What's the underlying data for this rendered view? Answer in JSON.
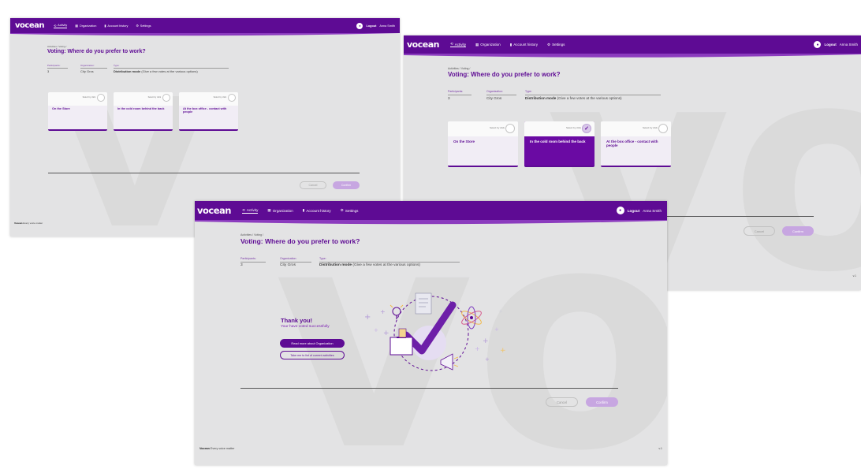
{
  "app": {
    "logo": "vocean",
    "nav": [
      {
        "label": "Activity",
        "icon": "activity-icon",
        "active": true
      },
      {
        "label": "Organization",
        "icon": "organization-icon"
      },
      {
        "label": "Account history",
        "icon": "account-history-icon"
      },
      {
        "label": "Settings",
        "icon": "gear-icon"
      }
    ],
    "logout": "Logout",
    "user": "Anna Smith",
    "footer_brand": "Vocean",
    "footer_tagline": "Every voice matter",
    "version": "v.1",
    "colors": {
      "brand": "#5e0b94",
      "background": "#e3e3e4",
      "confirm": "#c7a6e1"
    }
  },
  "poll": {
    "breadcrumb": "Activities / Voting /",
    "title": "Voting: Where do you prefer to work?",
    "participants_label": "Participants:",
    "participants": "3",
    "organization_label": "Organization:",
    "organization": "City Gros",
    "type_label": "Type:",
    "type_mode": "Distribution mode",
    "type_hint": "(Give a few votes at the various options)"
  },
  "options": [
    {
      "vote_label": "Select by click",
      "text": "On the Store"
    },
    {
      "vote_label": "Select by click",
      "text": "In the cold room behind the back"
    },
    {
      "vote_label": "Select by click",
      "text": "At the box office - contact with people"
    }
  ],
  "screens": [
    {
      "id": "initial",
      "selected_option": null
    },
    {
      "id": "selected",
      "selected_option": 2
    },
    {
      "id": "thank-you"
    }
  ],
  "actions": {
    "cancel": "Cancel",
    "confirm": "Confirm"
  },
  "thanks": {
    "title": "Thank you!",
    "subtitle": "Your have voted successfully",
    "btn_org": "Read more about Organization",
    "btn_list": "Take me to list of current activities"
  }
}
